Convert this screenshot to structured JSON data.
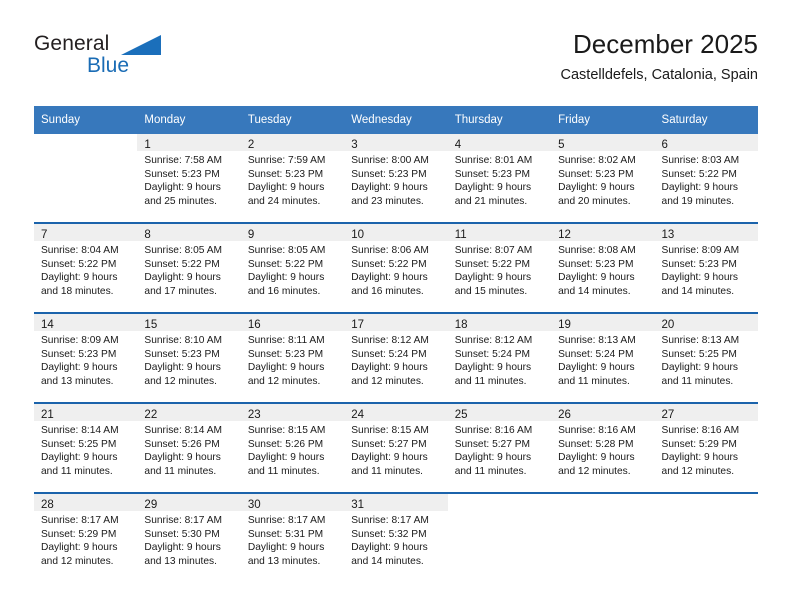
{
  "brand": {
    "name_top": "General",
    "name_bottom": "Blue",
    "accent_color": "#1b6fbb",
    "triangle_icon": "brand-triangle-icon"
  },
  "header": {
    "title": "December 2025",
    "subtitle": "Castelldefels, Catalonia, Spain"
  },
  "colors": {
    "header_row_bg": "#3778bc",
    "week_divider": "#1b63ab",
    "daynum_band_bg": "#efefef",
    "text": "#1a1a1a"
  },
  "calendar": {
    "day_headers": [
      "Sunday",
      "Monday",
      "Tuesday",
      "Wednesday",
      "Thursday",
      "Friday",
      "Saturday"
    ],
    "weeks": [
      [
        {
          "day": "",
          "lines": []
        },
        {
          "day": "1",
          "lines": [
            "Sunrise: 7:58 AM",
            "Sunset: 5:23 PM",
            "Daylight: 9 hours",
            "and 25 minutes."
          ]
        },
        {
          "day": "2",
          "lines": [
            "Sunrise: 7:59 AM",
            "Sunset: 5:23 PM",
            "Daylight: 9 hours",
            "and 24 minutes."
          ]
        },
        {
          "day": "3",
          "lines": [
            "Sunrise: 8:00 AM",
            "Sunset: 5:23 PM",
            "Daylight: 9 hours",
            "and 23 minutes."
          ]
        },
        {
          "day": "4",
          "lines": [
            "Sunrise: 8:01 AM",
            "Sunset: 5:23 PM",
            "Daylight: 9 hours",
            "and 21 minutes."
          ]
        },
        {
          "day": "5",
          "lines": [
            "Sunrise: 8:02 AM",
            "Sunset: 5:23 PM",
            "Daylight: 9 hours",
            "and 20 minutes."
          ]
        },
        {
          "day": "6",
          "lines": [
            "Sunrise: 8:03 AM",
            "Sunset: 5:22 PM",
            "Daylight: 9 hours",
            "and 19 minutes."
          ]
        }
      ],
      [
        {
          "day": "7",
          "lines": [
            "Sunrise: 8:04 AM",
            "Sunset: 5:22 PM",
            "Daylight: 9 hours",
            "and 18 minutes."
          ]
        },
        {
          "day": "8",
          "lines": [
            "Sunrise: 8:05 AM",
            "Sunset: 5:22 PM",
            "Daylight: 9 hours",
            "and 17 minutes."
          ]
        },
        {
          "day": "9",
          "lines": [
            "Sunrise: 8:05 AM",
            "Sunset: 5:22 PM",
            "Daylight: 9 hours",
            "and 16 minutes."
          ]
        },
        {
          "day": "10",
          "lines": [
            "Sunrise: 8:06 AM",
            "Sunset: 5:22 PM",
            "Daylight: 9 hours",
            "and 16 minutes."
          ]
        },
        {
          "day": "11",
          "lines": [
            "Sunrise: 8:07 AM",
            "Sunset: 5:22 PM",
            "Daylight: 9 hours",
            "and 15 minutes."
          ]
        },
        {
          "day": "12",
          "lines": [
            "Sunrise: 8:08 AM",
            "Sunset: 5:23 PM",
            "Daylight: 9 hours",
            "and 14 minutes."
          ]
        },
        {
          "day": "13",
          "lines": [
            "Sunrise: 8:09 AM",
            "Sunset: 5:23 PM",
            "Daylight: 9 hours",
            "and 14 minutes."
          ]
        }
      ],
      [
        {
          "day": "14",
          "lines": [
            "Sunrise: 8:09 AM",
            "Sunset: 5:23 PM",
            "Daylight: 9 hours",
            "and 13 minutes."
          ]
        },
        {
          "day": "15",
          "lines": [
            "Sunrise: 8:10 AM",
            "Sunset: 5:23 PM",
            "Daylight: 9 hours",
            "and 12 minutes."
          ]
        },
        {
          "day": "16",
          "lines": [
            "Sunrise: 8:11 AM",
            "Sunset: 5:23 PM",
            "Daylight: 9 hours",
            "and 12 minutes."
          ]
        },
        {
          "day": "17",
          "lines": [
            "Sunrise: 8:12 AM",
            "Sunset: 5:24 PM",
            "Daylight: 9 hours",
            "and 12 minutes."
          ]
        },
        {
          "day": "18",
          "lines": [
            "Sunrise: 8:12 AM",
            "Sunset: 5:24 PM",
            "Daylight: 9 hours",
            "and 11 minutes."
          ]
        },
        {
          "day": "19",
          "lines": [
            "Sunrise: 8:13 AM",
            "Sunset: 5:24 PM",
            "Daylight: 9 hours",
            "and 11 minutes."
          ]
        },
        {
          "day": "20",
          "lines": [
            "Sunrise: 8:13 AM",
            "Sunset: 5:25 PM",
            "Daylight: 9 hours",
            "and 11 minutes."
          ]
        }
      ],
      [
        {
          "day": "21",
          "lines": [
            "Sunrise: 8:14 AM",
            "Sunset: 5:25 PM",
            "Daylight: 9 hours",
            "and 11 minutes."
          ]
        },
        {
          "day": "22",
          "lines": [
            "Sunrise: 8:14 AM",
            "Sunset: 5:26 PM",
            "Daylight: 9 hours",
            "and 11 minutes."
          ]
        },
        {
          "day": "23",
          "lines": [
            "Sunrise: 8:15 AM",
            "Sunset: 5:26 PM",
            "Daylight: 9 hours",
            "and 11 minutes."
          ]
        },
        {
          "day": "24",
          "lines": [
            "Sunrise: 8:15 AM",
            "Sunset: 5:27 PM",
            "Daylight: 9 hours",
            "and 11 minutes."
          ]
        },
        {
          "day": "25",
          "lines": [
            "Sunrise: 8:16 AM",
            "Sunset: 5:27 PM",
            "Daylight: 9 hours",
            "and 11 minutes."
          ]
        },
        {
          "day": "26",
          "lines": [
            "Sunrise: 8:16 AM",
            "Sunset: 5:28 PM",
            "Daylight: 9 hours",
            "and 12 minutes."
          ]
        },
        {
          "day": "27",
          "lines": [
            "Sunrise: 8:16 AM",
            "Sunset: 5:29 PM",
            "Daylight: 9 hours",
            "and 12 minutes."
          ]
        }
      ],
      [
        {
          "day": "28",
          "lines": [
            "Sunrise: 8:17 AM",
            "Sunset: 5:29 PM",
            "Daylight: 9 hours",
            "and 12 minutes."
          ]
        },
        {
          "day": "29",
          "lines": [
            "Sunrise: 8:17 AM",
            "Sunset: 5:30 PM",
            "Daylight: 9 hours",
            "and 13 minutes."
          ]
        },
        {
          "day": "30",
          "lines": [
            "Sunrise: 8:17 AM",
            "Sunset: 5:31 PM",
            "Daylight: 9 hours",
            "and 13 minutes."
          ]
        },
        {
          "day": "31",
          "lines": [
            "Sunrise: 8:17 AM",
            "Sunset: 5:32 PM",
            "Daylight: 9 hours",
            "and 14 minutes."
          ]
        },
        {
          "day": "",
          "lines": []
        },
        {
          "day": "",
          "lines": []
        },
        {
          "day": "",
          "lines": []
        }
      ]
    ]
  }
}
